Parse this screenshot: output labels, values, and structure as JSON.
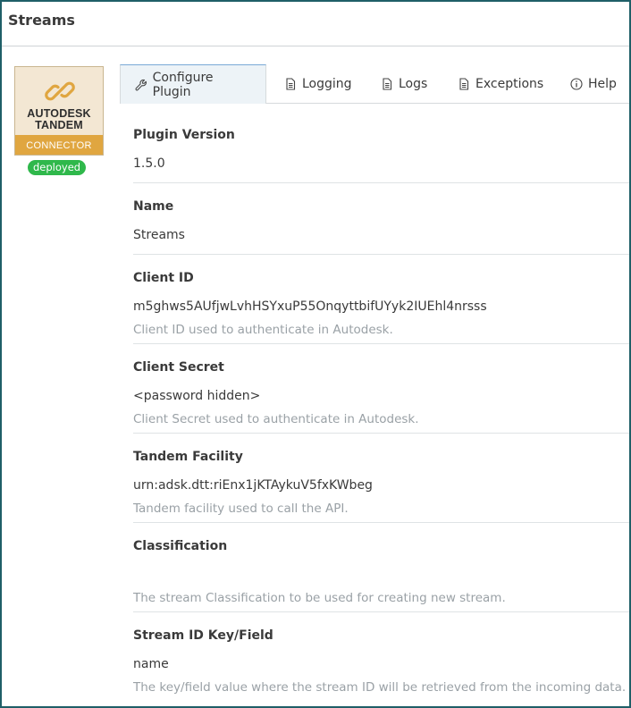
{
  "window": {
    "title": "Streams"
  },
  "plugin": {
    "logo_brand_line1": "AUTODESK",
    "logo_brand_line2": "TANDEM",
    "logo_band": "CONNECTOR",
    "status_badge": "deployed",
    "accent_color": "#e0a640",
    "status_color": "#2fb84b"
  },
  "tabs": [
    {
      "label": "Configure Plugin",
      "icon": "wrench-icon",
      "active": true
    },
    {
      "label": "Logging",
      "icon": "document-icon",
      "active": false
    },
    {
      "label": "Logs",
      "icon": "document-icon",
      "active": false
    },
    {
      "label": "Exceptions",
      "icon": "document-icon",
      "active": false
    },
    {
      "label": "Help",
      "icon": "info-icon",
      "active": false
    }
  ],
  "fields": [
    {
      "label": "Plugin Version",
      "value": "1.5.0",
      "help": ""
    },
    {
      "label": "Name",
      "value": "Streams",
      "help": ""
    },
    {
      "label": "Client ID",
      "value": "m5ghws5AUfjwLvhHSYxuP55OnqyttbifUYyk2IUEhl4nrsss",
      "help": "Client ID used to authenticate in Autodesk."
    },
    {
      "label": "Client Secret",
      "value": "<password hidden>",
      "help": "Client Secret used to authenticate in Autodesk."
    },
    {
      "label": "Tandem Facility",
      "value": "urn:adsk.dtt:riEnx1jKTAykuV5fxKWbeg",
      "help": "Tandem facility used to call the API."
    },
    {
      "label": "Classification",
      "value": "",
      "help": "The stream Classification to be used for creating new stream."
    },
    {
      "label": "Stream ID Key/Field",
      "value": "name",
      "help": "The key/field value where the stream ID will be retrieved from the incoming data."
    }
  ]
}
